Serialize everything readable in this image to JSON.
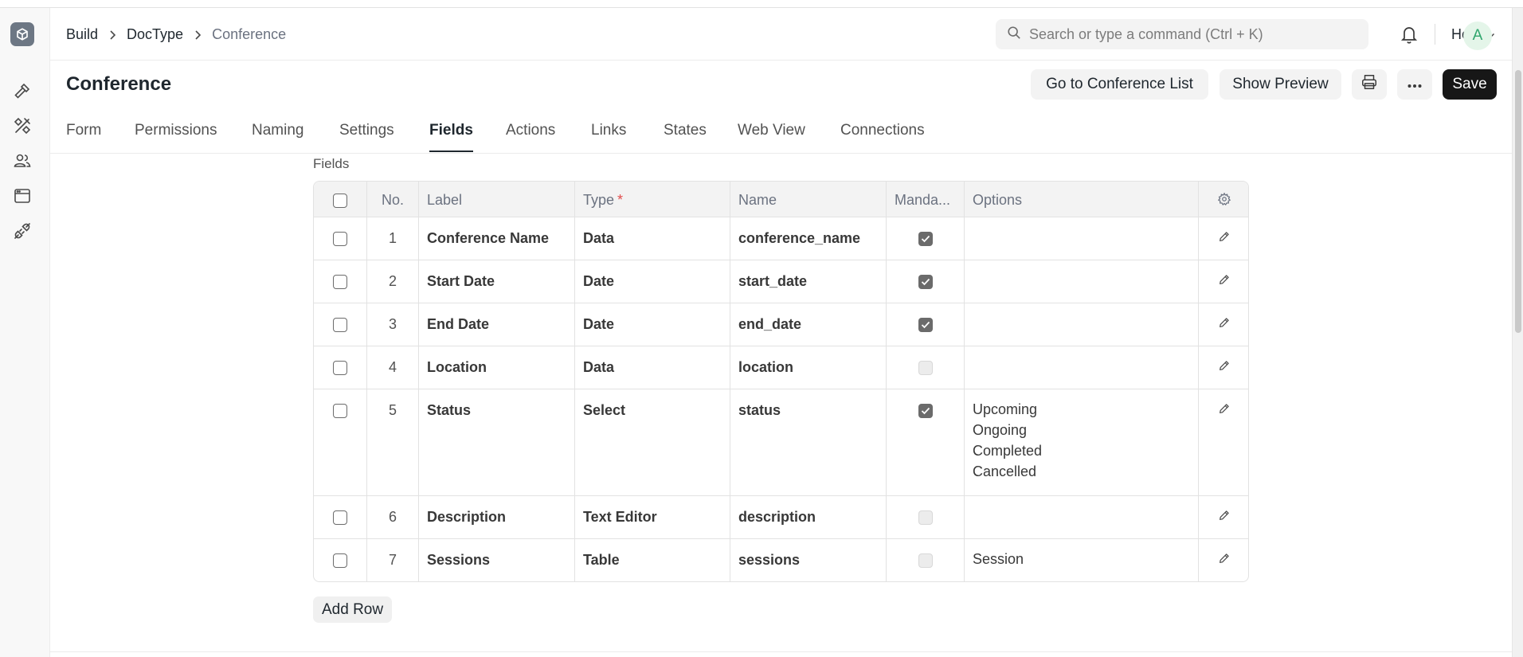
{
  "breadcrumb": {
    "items": [
      "Build",
      "DocType"
    ],
    "current": "Conference"
  },
  "search": {
    "placeholder": "Search or type a command (Ctrl + K)"
  },
  "help": {
    "label": "Help"
  },
  "avatar": {
    "initial": "A"
  },
  "page": {
    "title": "Conference"
  },
  "actions": {
    "go_to_list": "Go to Conference List",
    "show_preview": "Show Preview",
    "save": "Save"
  },
  "tabs": [
    "Form",
    "Permissions",
    "Naming",
    "Settings",
    "Fields",
    "Actions",
    "Links",
    "States",
    "Web View",
    "Connections"
  ],
  "active_tab": "Fields",
  "section": {
    "label": "Fields"
  },
  "table": {
    "headers": {
      "no": "No.",
      "label": "Label",
      "type": "Type",
      "type_required_mark": "*",
      "name": "Name",
      "mandatory": "Manda...",
      "options": "Options"
    },
    "rows": [
      {
        "no": "1",
        "label": "Conference Name",
        "type": "Data",
        "name": "conference_name",
        "mandatory": true,
        "options": ""
      },
      {
        "no": "2",
        "label": "Start Date",
        "type": "Date",
        "name": "start_date",
        "mandatory": true,
        "options": ""
      },
      {
        "no": "3",
        "label": "End Date",
        "type": "Date",
        "name": "end_date",
        "mandatory": true,
        "options": ""
      },
      {
        "no": "4",
        "label": "Location",
        "type": "Data",
        "name": "location",
        "mandatory": false,
        "options": ""
      },
      {
        "no": "5",
        "label": "Status",
        "type": "Select",
        "name": "status",
        "mandatory": true,
        "options": "Upcoming\nOngoing\nCompleted\nCancelled"
      },
      {
        "no": "6",
        "label": "Description",
        "type": "Text Editor",
        "name": "description",
        "mandatory": false,
        "options": ""
      },
      {
        "no": "7",
        "label": "Sessions",
        "type": "Table",
        "name": "sessions",
        "mandatory": false,
        "options": "Session"
      }
    ]
  },
  "add_row": {
    "label": "Add Row"
  },
  "colors": {
    "primary_button": "#171717",
    "avatar_bg": "#e4f5e9",
    "avatar_text": "#30a66d",
    "required_mark": "#e24c4c",
    "checkbox_checked": "#6b6b6b"
  }
}
